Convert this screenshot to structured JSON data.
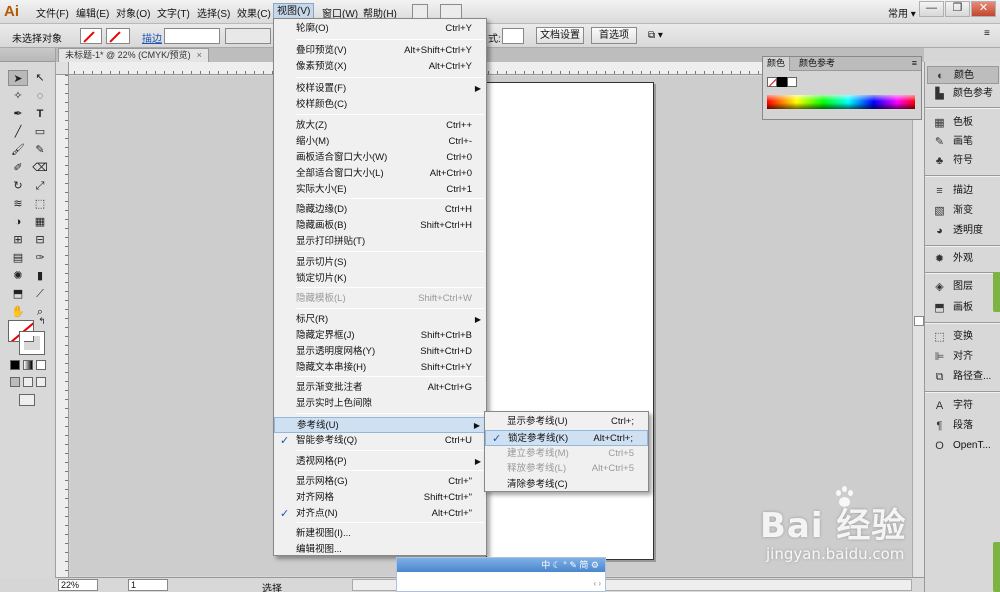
{
  "app": {
    "logo": "Ai"
  },
  "menubar": {
    "items": [
      "文件(F)",
      "编辑(E)",
      "对象(O)",
      "文字(T)",
      "选择(S)",
      "效果(C)",
      "视图(V)",
      "窗口(W)",
      "帮助(H)"
    ],
    "workspace": "常用",
    "minimize": "—",
    "restore": "❐",
    "close": "✕"
  },
  "controlbar": {
    "selection_status": "未选择对象",
    "stroke_label": "描边",
    "style_suffix": "式:",
    "doc_setup": "文档设置",
    "preferences": "首选项"
  },
  "document": {
    "tab_title": "未标题-1* @ 22% (CMYK/预览)",
    "tab_close": "×"
  },
  "statusbar": {
    "zoom": "22%",
    "page": "1",
    "mode": "选择"
  },
  "color_panel": {
    "tabs": [
      "颜色",
      "颜色参考"
    ]
  },
  "dock": {
    "items": [
      "颜色",
      "颜色参考",
      "色板",
      "画笔",
      "符号",
      "描边",
      "渐变",
      "透明度",
      "外观",
      "图层",
      "画板",
      "变换",
      "对齐",
      "路径查...",
      "字符",
      "段落",
      "OpenT..."
    ],
    "icons": [
      "color-icon",
      "color-guide-icon",
      "swatches-icon",
      "brushes-icon",
      "symbols-icon",
      "stroke-icon",
      "gradient-icon",
      "transparency-icon",
      "appearance-icon",
      "layers-icon",
      "artboards-icon",
      "transform-icon",
      "align-icon",
      "pathfinder-icon",
      "character-icon",
      "paragraph-icon",
      "opentype-icon"
    ]
  },
  "view_menu": {
    "items": [
      {
        "label": "轮廓(O)",
        "shortcut": "Ctrl+Y"
      },
      {
        "label": "叠印预览(V)",
        "shortcut": "Alt+Shift+Ctrl+Y"
      },
      {
        "label": "像素预览(X)",
        "shortcut": "Alt+Ctrl+Y"
      },
      {
        "label": "校样设置(F)",
        "shortcut": ""
      },
      {
        "label": "校样颜色(C)",
        "shortcut": ""
      },
      {
        "label": "放大(Z)",
        "shortcut": "Ctrl++"
      },
      {
        "label": "缩小(M)",
        "shortcut": "Ctrl+-"
      },
      {
        "label": "画板适合窗口大小(W)",
        "shortcut": "Ctrl+0"
      },
      {
        "label": "全部适合窗口大小(L)",
        "shortcut": "Alt+Ctrl+0"
      },
      {
        "label": "实际大小(E)",
        "shortcut": "Ctrl+1"
      },
      {
        "label": "隐藏边缘(D)",
        "shortcut": "Ctrl+H"
      },
      {
        "label": "隐藏画板(B)",
        "shortcut": "Shift+Ctrl+H"
      },
      {
        "label": "显示打印拼贴(T)",
        "shortcut": ""
      },
      {
        "label": "显示切片(S)",
        "shortcut": ""
      },
      {
        "label": "锁定切片(K)",
        "shortcut": ""
      },
      {
        "label": "隐藏模板(L)",
        "shortcut": "Shift+Ctrl+W"
      },
      {
        "label": "标尺(R)",
        "shortcut": ""
      },
      {
        "label": "隐藏定界框(J)",
        "shortcut": "Shift+Ctrl+B"
      },
      {
        "label": "显示透明度网格(Y)",
        "shortcut": "Shift+Ctrl+D"
      },
      {
        "label": "隐藏文本串接(H)",
        "shortcut": "Shift+Ctrl+Y"
      },
      {
        "label": "显示渐变批注者",
        "shortcut": "Alt+Ctrl+G"
      },
      {
        "label": "显示实时上色间隙",
        "shortcut": ""
      },
      {
        "label": "参考线(U)",
        "shortcut": ""
      },
      {
        "label": "智能参考线(Q)",
        "shortcut": "Ctrl+U"
      },
      {
        "label": "透视网格(P)",
        "shortcut": ""
      },
      {
        "label": "显示网格(G)",
        "shortcut": "Ctrl+\""
      },
      {
        "label": "对齐网格",
        "shortcut": "Shift+Ctrl+\""
      },
      {
        "label": "对齐点(N)",
        "shortcut": "Alt+Ctrl+\""
      },
      {
        "label": "新建视图(I)...",
        "shortcut": ""
      },
      {
        "label": "编辑视图...",
        "shortcut": ""
      }
    ],
    "check_mark": "✓",
    "submenu_arrow": "▶"
  },
  "guides_submenu": {
    "items": [
      {
        "label": "显示参考线(U)",
        "shortcut": "Ctrl+;"
      },
      {
        "label": "锁定参考线(K)",
        "shortcut": "Alt+Ctrl+;"
      },
      {
        "label": "建立参考线(M)",
        "shortcut": "Ctrl+5"
      },
      {
        "label": "释放参考线(L)",
        "shortcut": "Alt+Ctrl+5"
      },
      {
        "label": "清除参考线(C)",
        "shortcut": ""
      }
    ]
  },
  "ime": {
    "status": "中 ☾ ° ✎ 简 ⚙"
  },
  "watermark": {
    "brand": "Bai  经验",
    "url": "jingyan.baidu.com"
  }
}
